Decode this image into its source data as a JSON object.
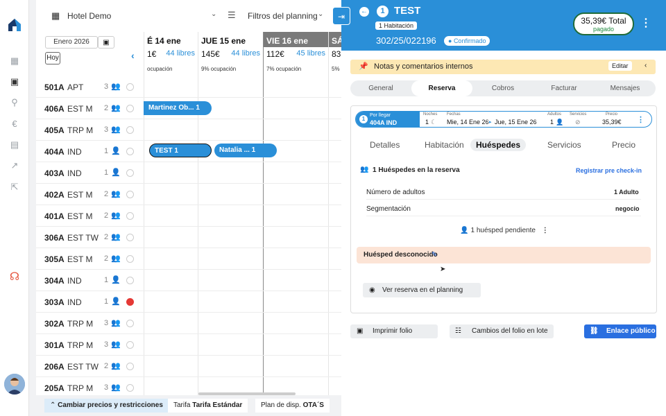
{
  "toolbar": {
    "hotel": "Hotel Demo",
    "filters": "Filtros del planning",
    "date": "Enero 2026",
    "today": "Hoy"
  },
  "days": [
    {
      "name": "É 14 ene",
      "price": "1€",
      "free": "44 libres",
      "occ": "ocupación"
    },
    {
      "name": "JUE 15 ene",
      "price": "145€",
      "free": "44 libres",
      "occ": "9% ocupación"
    },
    {
      "name": "VIE 16 ene",
      "price": "112€",
      "free": "45 libres",
      "occ": "7% ocupación"
    },
    {
      "name": "SÁ",
      "price": "83",
      "free": "",
      "occ": "5% o"
    }
  ],
  "rooms": [
    {
      "num": "501A",
      "type": "APT",
      "cap": "3",
      "status": "free"
    },
    {
      "num": "406A",
      "type": "EST M",
      "cap": "2",
      "status": "free"
    },
    {
      "num": "405A",
      "type": "TRP M",
      "cap": "3",
      "status": "free"
    },
    {
      "num": "404A",
      "type": "IND",
      "cap": "1",
      "status": "free"
    },
    {
      "num": "403A",
      "type": "IND",
      "cap": "1",
      "status": "free"
    },
    {
      "num": "402A",
      "type": "EST M",
      "cap": "2",
      "status": "free"
    },
    {
      "num": "401A",
      "type": "EST M",
      "cap": "2",
      "status": "free"
    },
    {
      "num": "306A",
      "type": "EST TW",
      "cap": "2",
      "status": "free"
    },
    {
      "num": "305A",
      "type": "EST M",
      "cap": "2",
      "status": "free"
    },
    {
      "num": "304A",
      "type": "IND",
      "cap": "1",
      "status": "free"
    },
    {
      "num": "303A",
      "type": "IND",
      "cap": "1",
      "status": "dirty"
    },
    {
      "num": "302A",
      "type": "TRP M",
      "cap": "3",
      "status": "free"
    },
    {
      "num": "301A",
      "type": "TRP M",
      "cap": "3",
      "status": "free"
    },
    {
      "num": "206A",
      "type": "EST TW",
      "cap": "2",
      "status": "free"
    },
    {
      "num": "205A",
      "type": "TRP M",
      "cap": "3",
      "status": "free"
    }
  ],
  "bookings": {
    "b1": "Martinez Ob... 1",
    "b2": "TEST 1",
    "b3": "Natalia ... 1"
  },
  "bottom": {
    "prices": "Cambiar precios y restricciones",
    "rate_label": "Tarifa",
    "rate": "Tarifa Estándar",
    "plan_label": "Plan de disp.",
    "plan": "OTA´S"
  },
  "panel": {
    "number": "1",
    "title": "TEST",
    "rooms": "1 Habitación",
    "code": "302/25/022196",
    "status": "Confirmado",
    "total": "35,39€ Total",
    "paid": "pagado",
    "notes": "Notas y comentarios internos",
    "edit": "Editar",
    "tabs": [
      "General",
      "Reserva",
      "Cobros",
      "Facturar",
      "Mensajes"
    ],
    "res": {
      "state": "Por llegar",
      "room": "404A IND",
      "nights_label": "Noches",
      "nights": "1",
      "dates_label": "Fechas",
      "checkin": "Mie, 14 Ene 26",
      "checkout": "Jue, 15 Ene 26",
      "adults_label": "Adultos",
      "adults": "1",
      "services_label": "Servicios",
      "price_label": "Precio",
      "price": "35,39€"
    },
    "subtabs": [
      "Detalles",
      "Habitación",
      "Huéspedes",
      "Servicios",
      "Precio"
    ],
    "guests": {
      "count": "1 Huéspedes en la reserva",
      "precheckin": "Registrar pre check-in",
      "adults_label": "Número de adultos",
      "adults": "1 Adulto",
      "seg_label": "Segmentación",
      "seg": "negocio",
      "pending": "1 huésped pendiente",
      "unknown": "Huésped desconocido",
      "view": "Ver reserva en el planning"
    },
    "actions": {
      "print": "Imprimir folio",
      "batch": "Cambios del folio en lote",
      "link": "Enlace público"
    }
  },
  "colors": {
    "primary": "#2a8fd8",
    "paid": "#1f6b3a",
    "notes_bg": "#fde8b4",
    "dirty": "#e53935"
  }
}
